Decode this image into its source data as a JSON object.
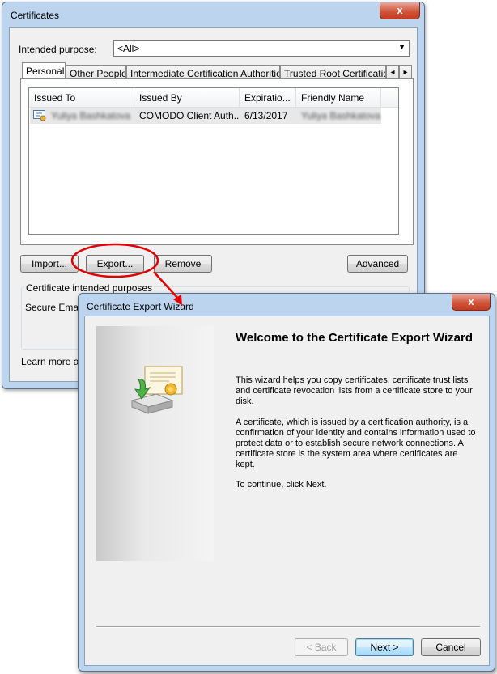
{
  "certificates_dialog": {
    "title": "Certificates",
    "close_glyph": "x",
    "intended_purpose_label": "Intended purpose:",
    "intended_purpose_value": "<All>",
    "tabs": [
      {
        "label": "Personal",
        "active": true
      },
      {
        "label": "Other People",
        "active": false
      },
      {
        "label": "Intermediate Certification Authorities",
        "active": false
      },
      {
        "label": "Trusted Root Certification",
        "active": false
      }
    ],
    "tab_scroll_left": "◂",
    "tab_scroll_right": "▸",
    "columns": [
      "Issued To",
      "Issued By",
      "Expiratio...",
      "Friendly Name"
    ],
    "rows": [
      {
        "issued_to": "Yuliya Bashkatova",
        "issued_by": "COMODO Client Auth...",
        "expiration": "6/13/2017",
        "friendly_name": "Yuliya Bashkatova"
      }
    ],
    "buttons": {
      "import": "Import...",
      "export": "Export...",
      "remove": "Remove",
      "advanced": "Advanced"
    },
    "purposes_group_label": "Certificate intended purposes",
    "purposes_value": "Secure Email,",
    "learn_more_text": "Learn more abo"
  },
  "wizard_dialog": {
    "title": "Certificate Export Wizard",
    "close_glyph": "x",
    "heading": "Welcome to the Certificate Export Wizard",
    "paragraphs": [
      "This wizard helps you copy certificates, certificate trust lists and certificate revocation lists from a certificate store to your disk.",
      "A certificate, which is issued by a certification authority, is a confirmation of your identity and contains information used to protect data or to establish secure network connections. A certificate store is the system area where certificates are kept.",
      "To continue, click Next."
    ],
    "buttons": {
      "back": "< Back",
      "next": "Next >",
      "cancel": "Cancel"
    }
  },
  "annotation": {
    "color": "#e00000"
  }
}
